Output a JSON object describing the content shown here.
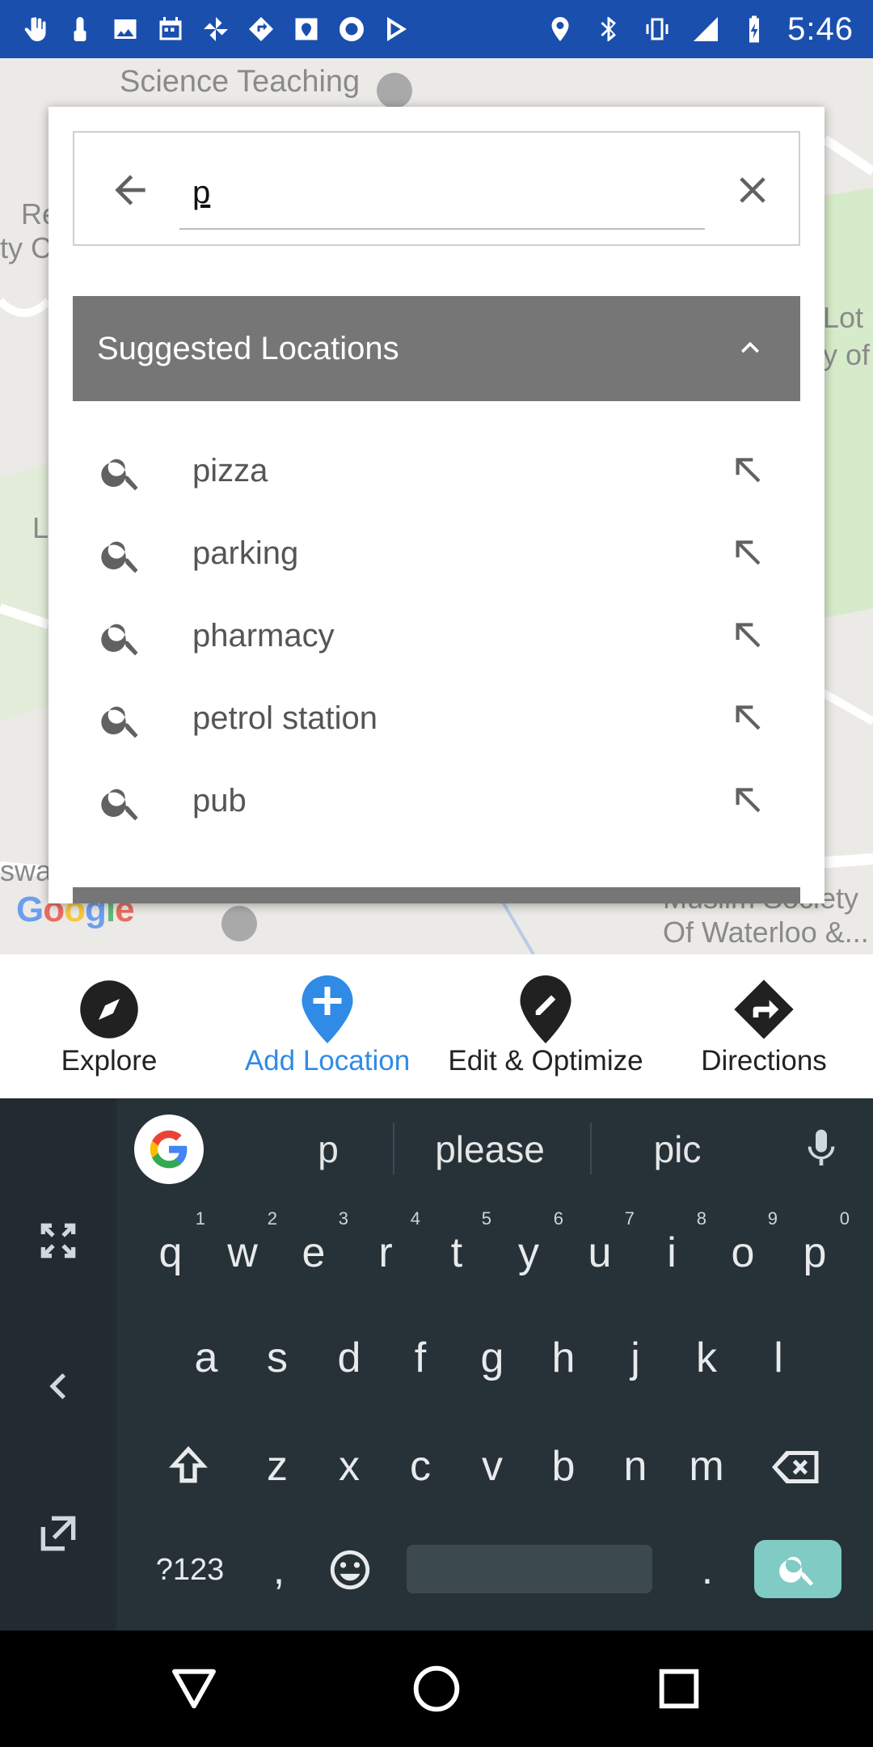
{
  "status_bar": {
    "time": "5:46",
    "left_icons": [
      "hand-icon",
      "touch-icon",
      "image-icon",
      "calendar-icon",
      "pinwheel-icon",
      "diamond-nav-icon",
      "maps-icon",
      "radio-icon",
      "play-store-icon"
    ],
    "right_icons": [
      "location-icon",
      "bluetooth-icon",
      "vibrate-icon",
      "signal-icon",
      "battery-charging-icon"
    ]
  },
  "map": {
    "labels": {
      "top": "Science Teaching",
      "left1": "Re",
      "left2": "ty C",
      "right1": "Lot",
      "right2": "y of",
      "left3": "L",
      "bottom_left": "swa",
      "bottom_right1": "Muslim Society",
      "bottom_right2": "Of Waterloo &..."
    },
    "logo": {
      "g1": "G",
      "o1": "o",
      "o2": "o",
      "g2": "g",
      "l": "l",
      "e": "e"
    }
  },
  "search": {
    "value": "p",
    "back_icon": "arrow-left-icon",
    "clear_icon": "close-icon"
  },
  "suggested": {
    "header": "Suggested Locations",
    "items": [
      {
        "label": "pizza"
      },
      {
        "label": "parking"
      },
      {
        "label": "pharmacy"
      },
      {
        "label": "petrol station"
      },
      {
        "label": "pub"
      }
    ]
  },
  "bottom_nav": {
    "items": [
      {
        "label": "Explore",
        "icon": "compass-icon"
      },
      {
        "label": "Add Location",
        "icon": "add-location-icon"
      },
      {
        "label": "Edit & Optimize",
        "icon": "edit-location-icon"
      },
      {
        "label": "Directions",
        "icon": "directions-icon"
      }
    ],
    "active_color": "#2f8be6"
  },
  "keyboard": {
    "suggestions": [
      "p",
      "please",
      "pic"
    ],
    "row1": [
      {
        "k": "q",
        "n": "1"
      },
      {
        "k": "w",
        "n": "2"
      },
      {
        "k": "e",
        "n": "3"
      },
      {
        "k": "r",
        "n": "4"
      },
      {
        "k": "t",
        "n": "5"
      },
      {
        "k": "y",
        "n": "6"
      },
      {
        "k": "u",
        "n": "7"
      },
      {
        "k": "i",
        "n": "8"
      },
      {
        "k": "o",
        "n": "9"
      },
      {
        "k": "p",
        "n": "0"
      }
    ],
    "row2": [
      "a",
      "s",
      "d",
      "f",
      "g",
      "h",
      "j",
      "k",
      "l"
    ],
    "row3": [
      "z",
      "x",
      "c",
      "v",
      "b",
      "n",
      "m"
    ],
    "symbols_label": "?123",
    "comma": ",",
    "period": ".",
    "accent": "#80cbc4"
  }
}
